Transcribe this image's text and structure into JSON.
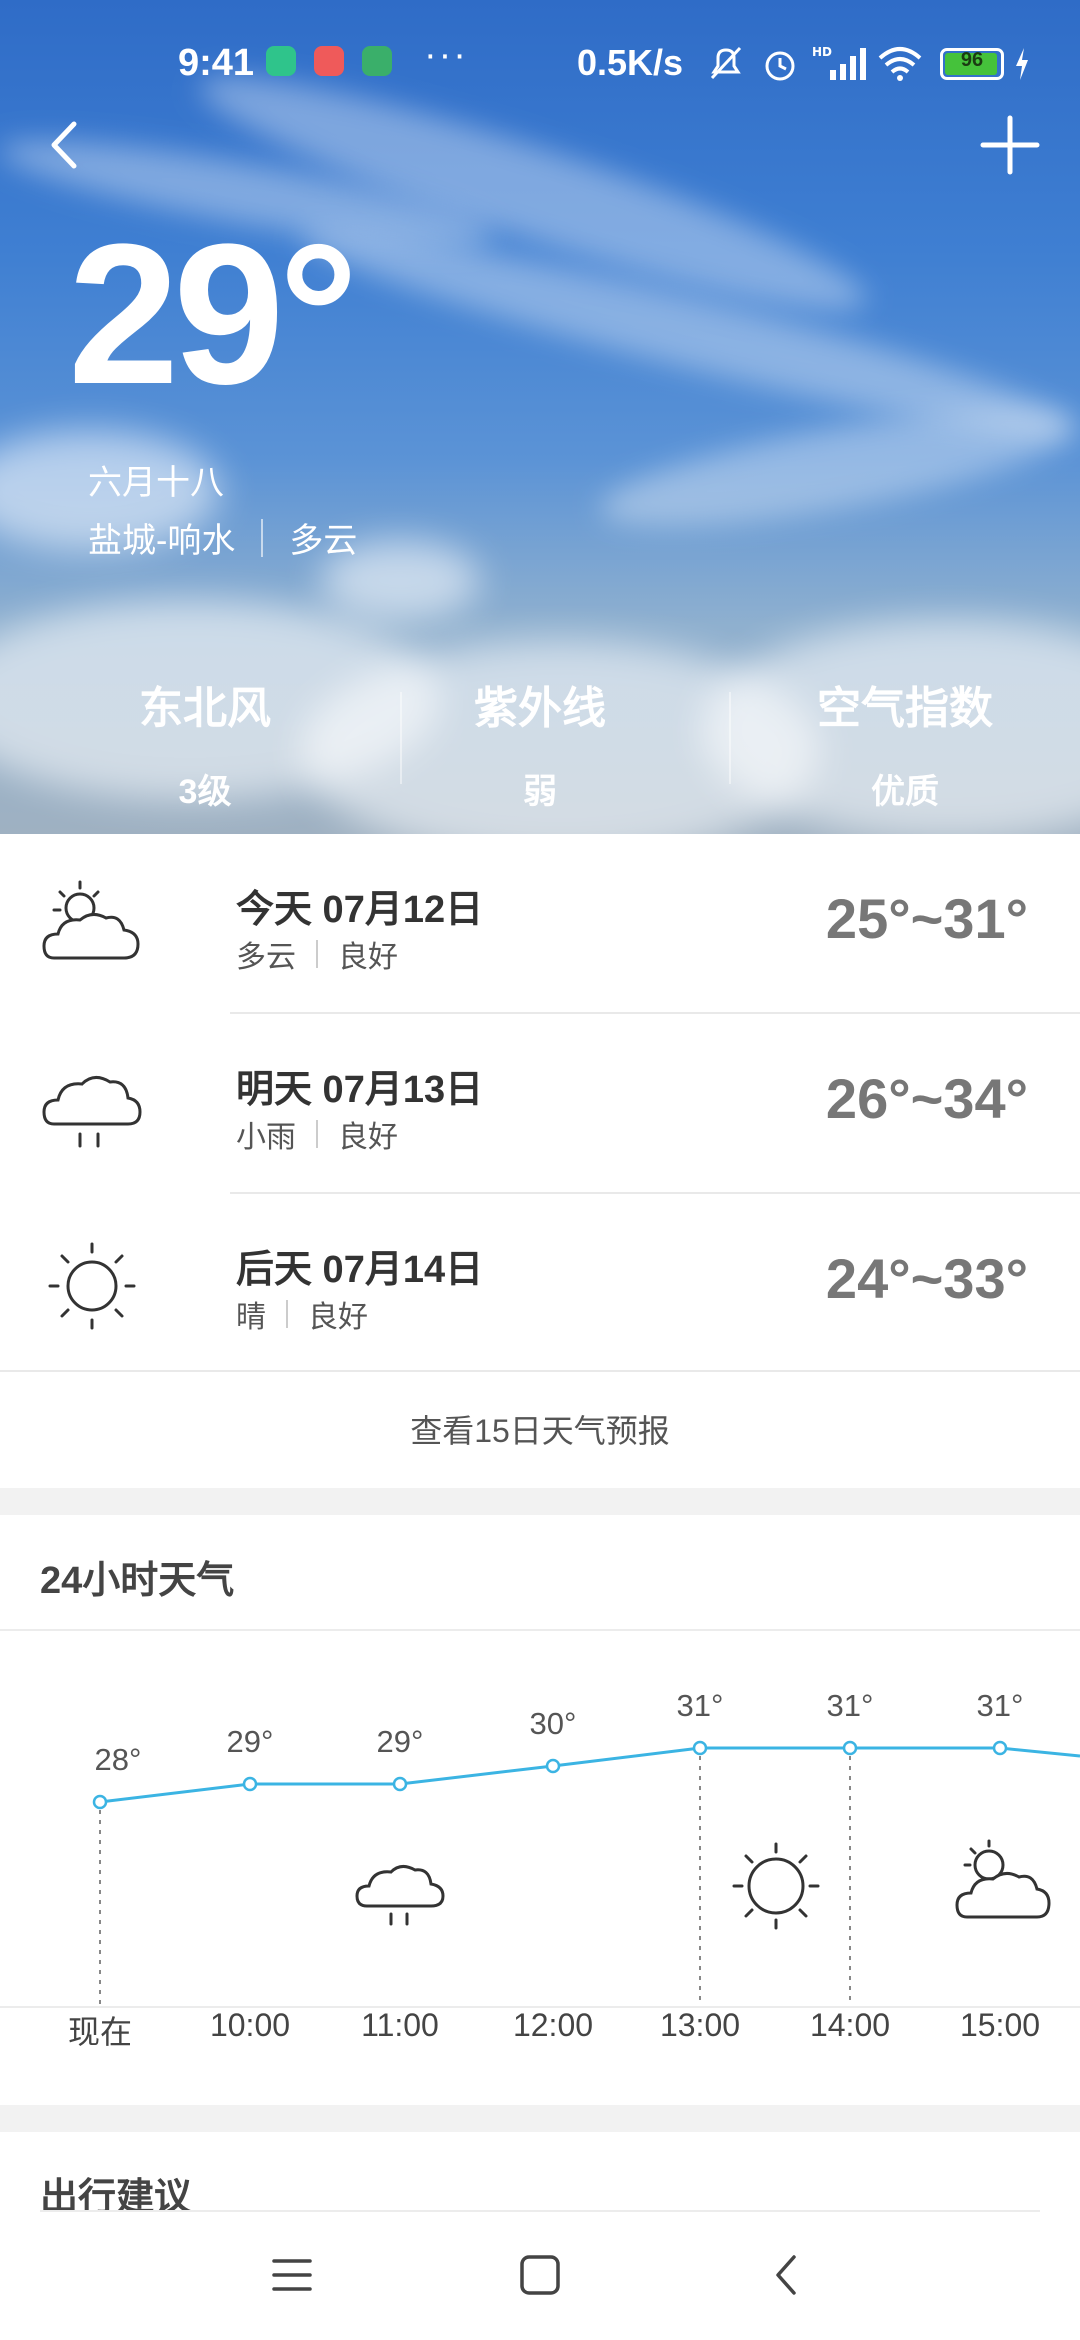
{
  "status_bar": {
    "time": "9:41",
    "more": "···",
    "net_speed": "0.5K/s",
    "battery_level": "96"
  },
  "weather": {
    "temperature": "29°",
    "lunar_date": "六月十八",
    "location": "盐城-响水",
    "condition": "多云"
  },
  "stats": [
    {
      "title": "东北风",
      "value": "3级"
    },
    {
      "title": "紫外线",
      "value": "弱"
    },
    {
      "title": "空气指数",
      "value": "优质"
    }
  ],
  "forecast": [
    {
      "day": "今天 07月12日",
      "condition": "多云",
      "air": "良好",
      "range": "25°~31°",
      "icon": "partly-cloudy-icon"
    },
    {
      "day": "明天 07月13日",
      "condition": "小雨",
      "air": "良好",
      "range": "26°~34°",
      "icon": "rain-icon"
    },
    {
      "day": "后天 07月14日",
      "condition": "晴",
      "air": "良好",
      "range": "24°~33°",
      "icon": "sun-icon"
    }
  ],
  "forecast_link": "查看15日天气预报",
  "hourly": {
    "title": "24小时天气",
    "hours": [
      "现在",
      "10:00",
      "11:00",
      "12:00",
      "13:00",
      "14:00",
      "15:00"
    ],
    "temps": [
      28,
      29,
      29,
      30,
      31,
      31,
      31
    ],
    "temp_labels": [
      "28°",
      "29°",
      "29°",
      "30°",
      "31°",
      "31°",
      "31°"
    ],
    "icons": [
      "rain-icon",
      "sun-icon",
      "partly-cloudy-icon"
    ]
  },
  "travel": {
    "title": "出行建议"
  },
  "colors": {
    "line": "#3bb4e3",
    "hero_sky": "#3f7fd2"
  }
}
